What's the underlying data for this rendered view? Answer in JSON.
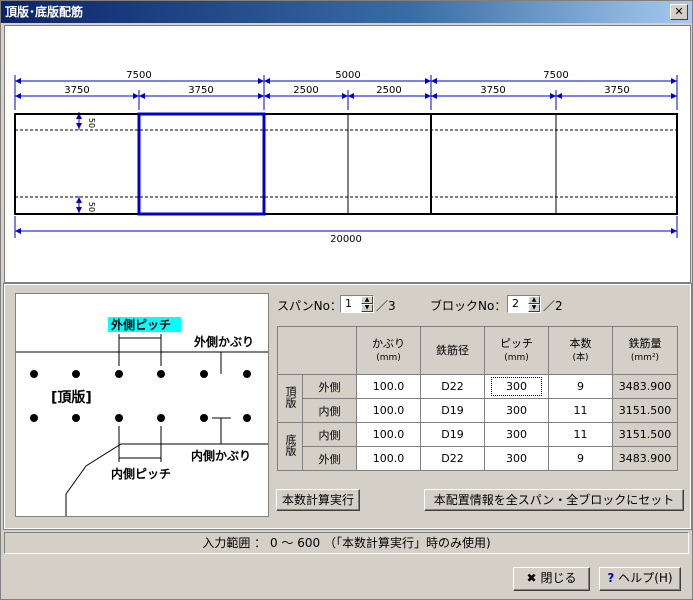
{
  "window": {
    "title": "頂版･底版配筋"
  },
  "diagram": {
    "top_dims": [
      "7500",
      "5000",
      "7500"
    ],
    "sub_dims": [
      "3750",
      "3750",
      "2500",
      "2500",
      "3750",
      "3750"
    ],
    "total_dim": "20000",
    "cover_top": "50",
    "cover_bottom": "50"
  },
  "section": {
    "outer_pitch": "外側ピッチ",
    "outer_cover": "外側かぶり",
    "slab_label": "[頂版]",
    "inner_pitch": "内側ピッチ",
    "inner_cover": "内側かぶり",
    "highlight_color": "#00ffff"
  },
  "span": {
    "label": "スパンNo：",
    "value": "1",
    "total": "／3"
  },
  "block": {
    "label": "ブロックNo：",
    "value": "2",
    "total": "／2"
  },
  "table": {
    "headers": {
      "cover": "かぶり",
      "cover_unit": "(mm)",
      "diameter": "鉄筋径",
      "pitch": "ピッチ",
      "pitch_unit": "(mm)",
      "count": "本数",
      "count_unit": "(本)",
      "amount": "鉄筋量",
      "amount_unit": "(mm²)"
    },
    "groups": [
      {
        "name": "頂版",
        "rows": [
          {
            "side": "外側",
            "cover": "100.0",
            "diameter": "D22",
            "pitch": "300",
            "count": "9",
            "amount": "3483.900"
          },
          {
            "side": "内側",
            "cover": "100.0",
            "diameter": "D19",
            "pitch": "300",
            "count": "11",
            "amount": "3151.500"
          }
        ]
      },
      {
        "name": "底版",
        "rows": [
          {
            "side": "内側",
            "cover": "100.0",
            "diameter": "D19",
            "pitch": "300",
            "count": "11",
            "amount": "3151.500"
          },
          {
            "side": "外側",
            "cover": "100.0",
            "diameter": "D22",
            "pitch": "300",
            "count": "9",
            "amount": "3483.900"
          }
        ]
      }
    ]
  },
  "buttons": {
    "calc": "本数計算実行",
    "apply_all": "本配置情報を全スパン・全ブロックにセット",
    "close": "閉じる",
    "help": "ヘルプ(H)"
  },
  "status": {
    "text": "入力範囲 ： 0 ～ 600 （「本数計算実行」時のみ使用)"
  },
  "colors": {
    "selected_block": "#0000cc",
    "dim_line": "#0000cc"
  }
}
